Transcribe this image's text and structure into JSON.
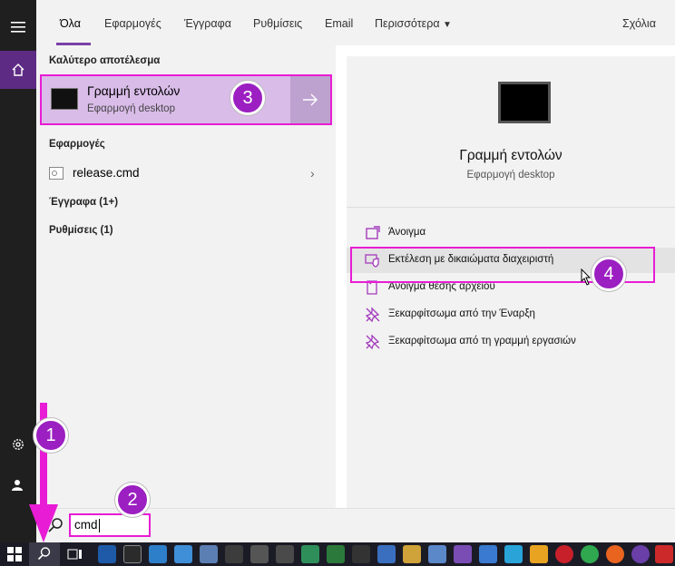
{
  "tabs": [
    {
      "label": "Όλα",
      "active": true
    },
    {
      "label": "Εφαρμογές"
    },
    {
      "label": "Έγγραφα"
    },
    {
      "label": "Ρυθμίσεις"
    },
    {
      "label": "Email"
    },
    {
      "label": "Περισσότερα"
    }
  ],
  "feedback_label": "Σχόλια",
  "results": {
    "best_header": "Καλύτερο αποτέλεσμα",
    "best": {
      "title": "Γραμμή εντολών",
      "subtitle": "Εφαρμογή desktop"
    },
    "apps_header": "Εφαρμογές",
    "app_item": "release.cmd",
    "docs_header": "Έγγραφα (1+)",
    "settings_header": "Ρυθμίσεις (1)"
  },
  "preview": {
    "title": "Γραμμή εντολών",
    "subtitle": "Εφαρμογή desktop",
    "actions": [
      {
        "label": "Άνοιγμα",
        "icon": "open-icon"
      },
      {
        "label": "Εκτέλεση με δικαιώματα διαχειριστή",
        "icon": "shield-icon"
      },
      {
        "label": "Άνοιγμα θέσης αρχείου",
        "icon": "folder-icon"
      },
      {
        "label": "Ξεκαρφίτσωμα από την Έναρξη",
        "icon": "unpin-icon"
      },
      {
        "label": "Ξεκαρφίτσωμα από τη γραμμή εργασιών",
        "icon": "unpin-icon"
      }
    ]
  },
  "search": {
    "value": "cmd"
  },
  "annotations": [
    "1",
    "2",
    "3",
    "4"
  ],
  "colors": {
    "accent": "#7a3fa8",
    "highlight": "#e81cd4",
    "badge": "#9b1fc1",
    "best_bg": "#d9bce8"
  }
}
